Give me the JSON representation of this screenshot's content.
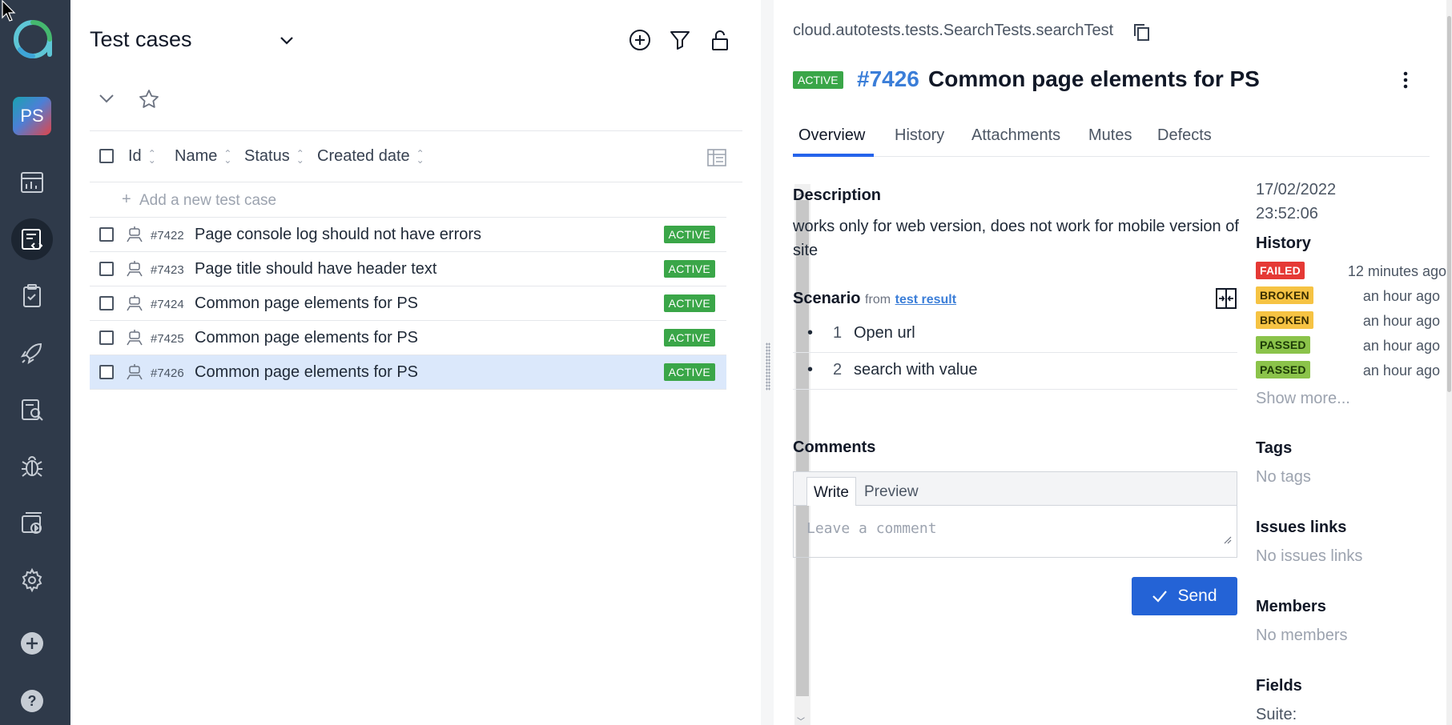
{
  "sidebar": {
    "project_initials": "PS"
  },
  "list": {
    "title": "Test cases",
    "columns": [
      "Id",
      "Name",
      "Status",
      "Created date"
    ],
    "add_placeholder": "Add a new test case",
    "rows": [
      {
        "id": "#7422",
        "name": "Page console log should not have errors",
        "status": "ACTIVE"
      },
      {
        "id": "#7423",
        "name": "Page title should have header text",
        "status": "ACTIVE"
      },
      {
        "id": "#7424",
        "name": "Common page elements for PS",
        "status": "ACTIVE"
      },
      {
        "id": "#7425",
        "name": "Common page elements for PS",
        "status": "ACTIVE"
      },
      {
        "id": "#7426",
        "name": "Common page elements for PS",
        "status": "ACTIVE"
      }
    ]
  },
  "detail": {
    "path": "cloud.autotests.tests.SearchTests.searchTest",
    "status": "ACTIVE",
    "id": "#7426",
    "name": "Common page elements for PS",
    "tabs": [
      "Overview",
      "History",
      "Attachments",
      "Mutes",
      "Defects"
    ],
    "description_title": "Description",
    "description": "works only for web version, does not work for mobile version of site",
    "scenario_title": "Scenario",
    "scenario_from": "from",
    "scenario_link": "test result",
    "steps": [
      {
        "bullet": "•",
        "num": "1",
        "text": "Open url"
      },
      {
        "bullet": "•",
        "num": "2",
        "text": "search with value"
      }
    ],
    "comments_title": "Comments",
    "comment_tabs": {
      "write": "Write",
      "preview": "Preview"
    },
    "comment_placeholder": "Leave a comment",
    "send_label": "Send"
  },
  "side": {
    "date": "17/02/2022",
    "time": "23:52:06",
    "history_title": "History",
    "history": [
      {
        "status": "FAILED",
        "when": "12 minutes ago"
      },
      {
        "status": "BROKEN",
        "when": "an hour ago"
      },
      {
        "status": "BROKEN",
        "when": "an hour ago"
      },
      {
        "status": "PASSED",
        "when": "an hour ago"
      },
      {
        "status": "PASSED",
        "when": "an hour ago"
      }
    ],
    "show_more": "Show more...",
    "tags_title": "Tags",
    "tags_value": "No tags",
    "issues_title": "Issues links",
    "issues_value": "No issues links",
    "members_title": "Members",
    "members_value": "No members",
    "fields_title": "Fields",
    "suite_label": "Suite:"
  },
  "colors": {
    "sidebar": "#2f3a4a",
    "active_badge": "#3aa648",
    "accent": "#2463d6",
    "link": "#3b7ed8",
    "selected_row": "#dbe8fb",
    "failed": "#e53935",
    "broken": "#f6c343",
    "passed": "#8bc34a"
  },
  "icons": [
    "allure-logo",
    "dashboard-icon",
    "testcases-icon",
    "testplan-icon",
    "launch-icon",
    "analytics-icon",
    "defects-icon",
    "jobs-icon",
    "settings-icon",
    "add-icon",
    "help-icon",
    "add-circle-icon",
    "filter-icon",
    "unlock-icon",
    "chevron-down-icon",
    "star-icon",
    "column-settings-icon",
    "robot-icon",
    "copy-icon",
    "kebab-icon",
    "split-view-icon",
    "check-icon"
  ]
}
